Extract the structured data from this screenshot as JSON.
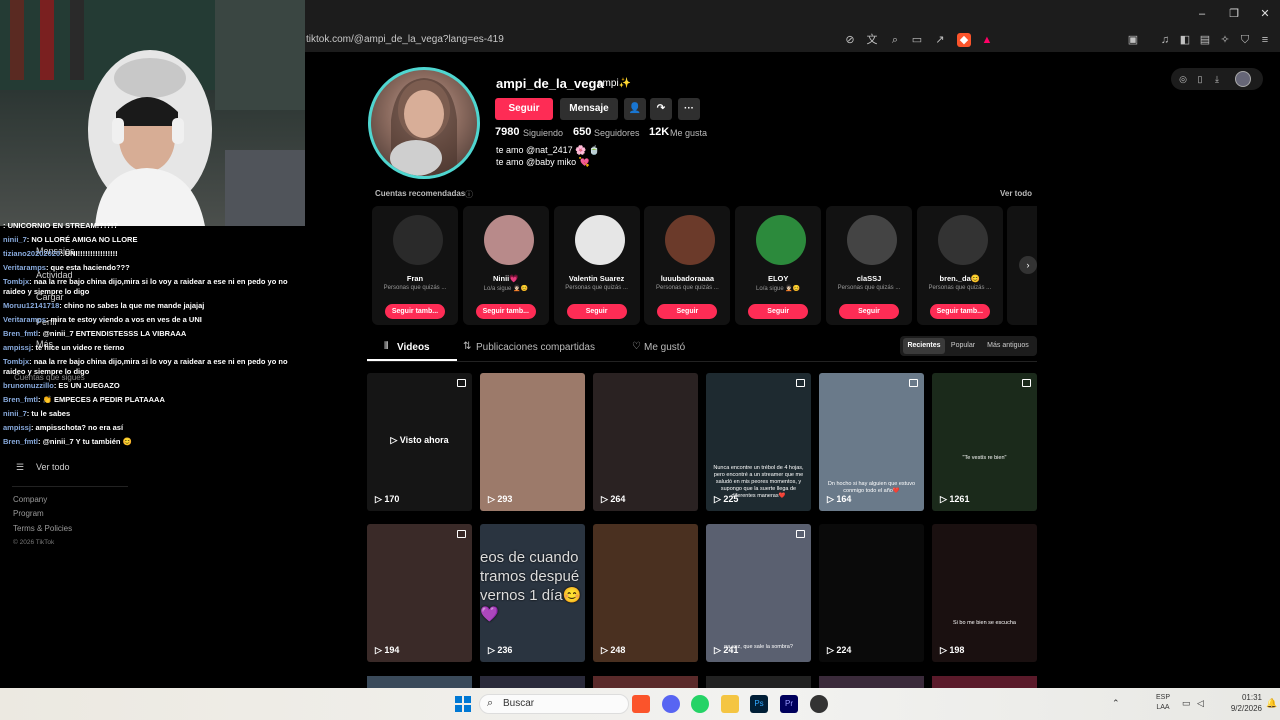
{
  "browser": {
    "url": "tiktok.com/@ampi_de_la_vega?lang=es-419"
  },
  "sidebar": {
    "items": [
      "Actividad",
      "Mensajes",
      "Cargar",
      "Perfil",
      "Más",
      "Cuentas que sigues",
      "Ver todo"
    ],
    "footer": [
      "Company",
      "Program",
      "Terms & Policies",
      "© 2026 TikTok"
    ]
  },
  "chat": {
    "messages": [
      {
        "user": "",
        "text": ": UNICORNIO EN STREAM!?!?!?"
      },
      {
        "user": "ninii_7",
        "text": ": NO LLORÉ AMIGA NO LLORE"
      },
      {
        "user": "tiziano20202020",
        "text": ": UNI!!!!!!!!!!!!!!!!"
      },
      {
        "user": "Veritaramps",
        "text": ": que esta haciendo???"
      },
      {
        "user": "Tombjx",
        "text": ": naa la rre bajo china dijo,mira si lo voy a raidear a ese ni en pedo yo no raideo y siempre lo digo"
      },
      {
        "user": "Moruu12141718",
        "text": ": chino no sabes la que me mande jajajaj"
      },
      {
        "user": "Veritaramps",
        "text": ": mira te estoy viendo a vos en ves de a UNI"
      },
      {
        "user": "Bren_fmtl",
        "text": ": @ninii_7 ENTENDISTESSS LA VIBRAAA"
      },
      {
        "user": "ampissj",
        "text": ": te hice un video re tierno"
      },
      {
        "user": "Tombjx",
        "text": ": naa la rre bajo china dijo,mira si lo voy a raidear a ese ni en pedo yo no raideo y siempre lo digo"
      },
      {
        "user": "brunomuzzillo",
        "text": ": ES UN JUEGAZO"
      },
      {
        "user": "Bren_fmtl",
        "text": ": 👏 EMPECES A PEDIR PLATAAAA"
      },
      {
        "user": "ninii_7",
        "text": ": tu le sabes"
      },
      {
        "user": "ampissj",
        "text": ": ampisschota? no era así"
      },
      {
        "user": "Bren_fmtl",
        "text": ": @ninii_7 Y tu también 😊"
      }
    ]
  },
  "profile": {
    "username": "ampi_de_la_vega",
    "nickname": "ampi✨",
    "follow_label": "Seguir",
    "message_label": "Mensaje",
    "following_count": "7980",
    "following_label": "Siguiendo",
    "followers_count": "650",
    "followers_label": "Seguidores",
    "likes_count": "12K",
    "likes_label": "Me gusta",
    "bio_line1": "te amo @nat_2417 🌸 🍵",
    "bio_line2": "te amo @baby miko 💘"
  },
  "recommended": {
    "title": "Cuentas recomendadas",
    "see_all": "Ver todo",
    "cards": [
      {
        "name": "Fran",
        "sub": "Personas que quizás ...",
        "btn": "Seguir tamb...",
        "color": "#2a2a2a"
      },
      {
        "name": "Ninii💗",
        "sub": "Lo/a sigue 🧑🏻‍🦱😊",
        "btn": "Seguir tamb...",
        "color": "#b88a8a"
      },
      {
        "name": "Valentin Suarez",
        "sub": "Personas que quizás ...",
        "btn": "Seguir",
        "color": "#e6e6e6"
      },
      {
        "name": "luuubadoraaaa",
        "sub": "Personas que quizás ...",
        "btn": "Seguir",
        "color": "#6b3a2a"
      },
      {
        "name": "ELOY",
        "sub": "Lo/a sigue 🧑🏻‍🦱😊",
        "btn": "Seguir",
        "color": "#2c8a3c"
      },
      {
        "name": "claSSJ",
        "sub": "Personas que quizás ...",
        "btn": "Seguir",
        "color": "#444"
      },
      {
        "name": "bren._da😊",
        "sub": "Personas que quizás ...",
        "btn": "Seguir tamb...",
        "color": "#333"
      }
    ]
  },
  "tabs": {
    "videos": "Videos",
    "shared": "Publicaciones compartidas",
    "liked": "Me gustó",
    "sort": [
      "Recientes",
      "Popular",
      "Más antiguos"
    ]
  },
  "videos": [
    {
      "count": "170",
      "overlay": "Visto ahora",
      "caption": "",
      "bg": "#151515"
    },
    {
      "count": "293",
      "overlay": "",
      "caption": "",
      "bg": "#9c7a6a"
    },
    {
      "count": "264",
      "overlay": "",
      "caption": "",
      "bg": "#2a2222"
    },
    {
      "count": "225",
      "overlay": "",
      "caption": "Nunca encontre un trébol de 4 hojas, pero encontré a un streamer que me saludó en mis peores momentos, y supongo que la suerte llega de diferentes maneras❤️",
      "bg": "#1e2a30"
    },
    {
      "count": "164",
      "overlay": "",
      "caption": "Dn hocho si hay alguien que estuvo conmigo todo el año❤️",
      "bg": "#6a7a8a"
    },
    {
      "count": "1261",
      "overlay": "",
      "caption": "\"Te vestís re bien\"",
      "bg": "#1b2a1b"
    },
    {
      "count": "194",
      "overlay": "",
      "caption": "",
      "bg": "#3a2a28"
    },
    {
      "count": "236",
      "overlay": "eos de cuando tramos despué vernos 1 día😊💜",
      "caption": "",
      "bg": "#2a3440"
    },
    {
      "count": "248",
      "overlay": "",
      "caption": "",
      "bg": "#4a3020"
    },
    {
      "count": "241",
      "overlay": "",
      "caption": "na vez, que sale la sombra?",
      "bg": "#5a6070"
    },
    {
      "count": "224",
      "overlay": "",
      "caption": "",
      "bg": "#0a0a0a"
    },
    {
      "count": "198",
      "overlay": "",
      "caption": "Si bo me bien se escucha",
      "bg": "#1a1010"
    }
  ],
  "taskbar": {
    "search_label": "Buscar",
    "lang": "ESP",
    "lang2": "LAA",
    "time": "01:31",
    "date": "9/2/2026"
  }
}
